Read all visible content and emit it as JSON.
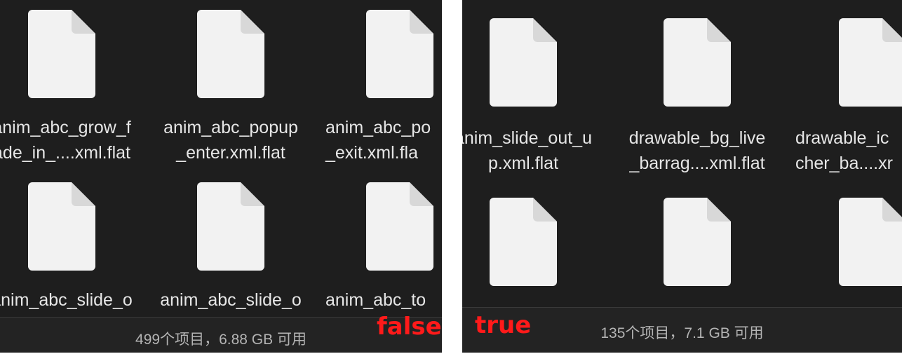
{
  "left_panel": {
    "files": [
      {
        "name": "anim_abc_grow_f\nade_in_....xml.flat"
      },
      {
        "name": "anim_abc_popup\n_enter.xml.flat"
      },
      {
        "name": "anim_abc_po\n_exit.xml.fla"
      },
      {
        "name": "anim_abc_slide_o"
      },
      {
        "name": "anim_abc_slide_o"
      },
      {
        "name": "anim_abc_to"
      }
    ],
    "status": "499个项目，6.88 GB 可用",
    "tag": "false",
    "tag_color": "#ff1a1a"
  },
  "right_panel": {
    "files": [
      {
        "name": "anim_slide_out_u\np.xml.flat"
      },
      {
        "name": "drawable_bg_live\n_barrag....xml.flat"
      },
      {
        "name": "drawable_ic\ncher_ba....xr"
      },
      {
        "name": ""
      },
      {
        "name": ""
      },
      {
        "name": ""
      }
    ],
    "status": "135个项目，7.1 GB 可用",
    "tag": "true",
    "tag_color": "#ff1a1a"
  },
  "icons": {
    "file": "generic-document-icon"
  },
  "colors": {
    "background": "#1e1e1e",
    "icon": "#f2f2f2",
    "text": "#e6e6e6",
    "status_text": "#b4b4b4"
  }
}
